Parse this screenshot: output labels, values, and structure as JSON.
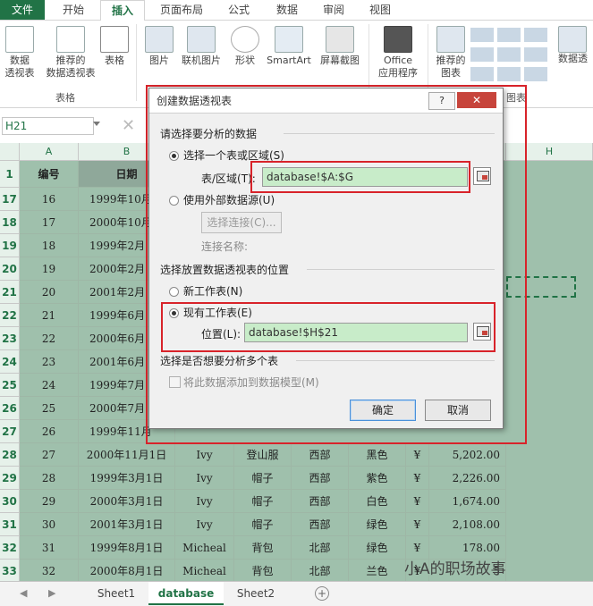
{
  "ribbon_tabs": [
    "文件",
    "开始",
    "插入",
    "页面布局",
    "公式",
    "数据",
    "审阅",
    "视图"
  ],
  "ribbon": {
    "pivot_label1": "数据",
    "pivot_label2": "透视表",
    "rec_pivot_label1": "推荐的",
    "rec_pivot_label2": "数据透视表",
    "table_label": "表格",
    "group_tables": "表格",
    "picture_label": "图片",
    "online_picture_label": "联机图片",
    "shapes_label": "形状",
    "smartart_label": "SmartArt",
    "screenshot_label": "屏幕截图",
    "office_label1": "Office",
    "office_label2": "应用程序",
    "rec_chart_label1": "推荐的",
    "rec_chart_label2": "图表",
    "pivotchart_label": "数据透",
    "group_charts": "图表"
  },
  "namebox": "H21",
  "columns": [
    "A",
    "B",
    "H"
  ],
  "header_row": {
    "row": "1",
    "a": "编号",
    "b": "日期"
  },
  "rows": [
    {
      "row": "17",
      "a": "16",
      "b": "1999年10月"
    },
    {
      "row": "18",
      "a": "17",
      "b": "2000年10月"
    },
    {
      "row": "19",
      "a": "18",
      "b": "1999年2月"
    },
    {
      "row": "20",
      "a": "19",
      "b": "2000年2月"
    },
    {
      "row": "21",
      "a": "20",
      "b": "2001年2月"
    },
    {
      "row": "22",
      "a": "21",
      "b": "1999年6月"
    },
    {
      "row": "23",
      "a": "22",
      "b": "2000年6月"
    },
    {
      "row": "24",
      "a": "23",
      "b": "2001年6月"
    },
    {
      "row": "25",
      "a": "24",
      "b": "1999年7月"
    },
    {
      "row": "26",
      "a": "25",
      "b": "2000年7月"
    },
    {
      "row": "27",
      "a": "26",
      "b": "1999年11月"
    }
  ],
  "full_rows": [
    {
      "row": "28",
      "a": "27",
      "b": "2000年11月1日",
      "c": "Ivy",
      "d": "登山服",
      "e": "西部",
      "f": "黑色",
      "cur": "¥",
      "g": "5,202.00"
    },
    {
      "row": "29",
      "a": "28",
      "b": "1999年3月1日",
      "c": "Ivy",
      "d": "帽子",
      "e": "西部",
      "f": "紫色",
      "cur": "¥",
      "g": "2,226.00"
    },
    {
      "row": "30",
      "a": "29",
      "b": "2000年3月1日",
      "c": "Ivy",
      "d": "帽子",
      "e": "西部",
      "f": "白色",
      "cur": "¥",
      "g": "1,674.00"
    },
    {
      "row": "31",
      "a": "30",
      "b": "2001年3月1日",
      "c": "Ivy",
      "d": "帽子",
      "e": "西部",
      "f": "绿色",
      "cur": "¥",
      "g": "2,108.00"
    },
    {
      "row": "32",
      "a": "31",
      "b": "1999年8月1日",
      "c": "Micheal",
      "d": "背包",
      "e": "北部",
      "f": "绿色",
      "cur": "¥",
      "g": "178.00"
    },
    {
      "row": "33",
      "a": "32",
      "b": "2000年8月1日",
      "c": "Micheal",
      "d": "背包",
      "e": "北部",
      "f": "兰色",
      "cur": "¥",
      "g": "5"
    }
  ],
  "dialog": {
    "title": "创建数据透视表",
    "help": "?",
    "close": "✕",
    "section1": "请选择要分析的数据",
    "opt_select_range": "选择一个表或区域(S)",
    "range_label": "表/区域(T):",
    "range_value": "database!$A:$G",
    "opt_external": "使用外部数据源(U)",
    "choose_conn": "选择连接(C)...",
    "conn_name": "连接名称:",
    "section2": "选择放置数据透视表的位置",
    "opt_new_sheet": "新工作表(N)",
    "opt_existing": "现有工作表(E)",
    "location_label": "位置(L):",
    "location_value": "database!$H$21",
    "section3": "选择是否想要分析多个表",
    "add_model": "将此数据添加到数据模型(M)",
    "ok": "确定",
    "cancel": "取消"
  },
  "sheet_tabs": [
    "Sheet1",
    "database",
    "Sheet2"
  ],
  "watermark": "小A的职场故事"
}
